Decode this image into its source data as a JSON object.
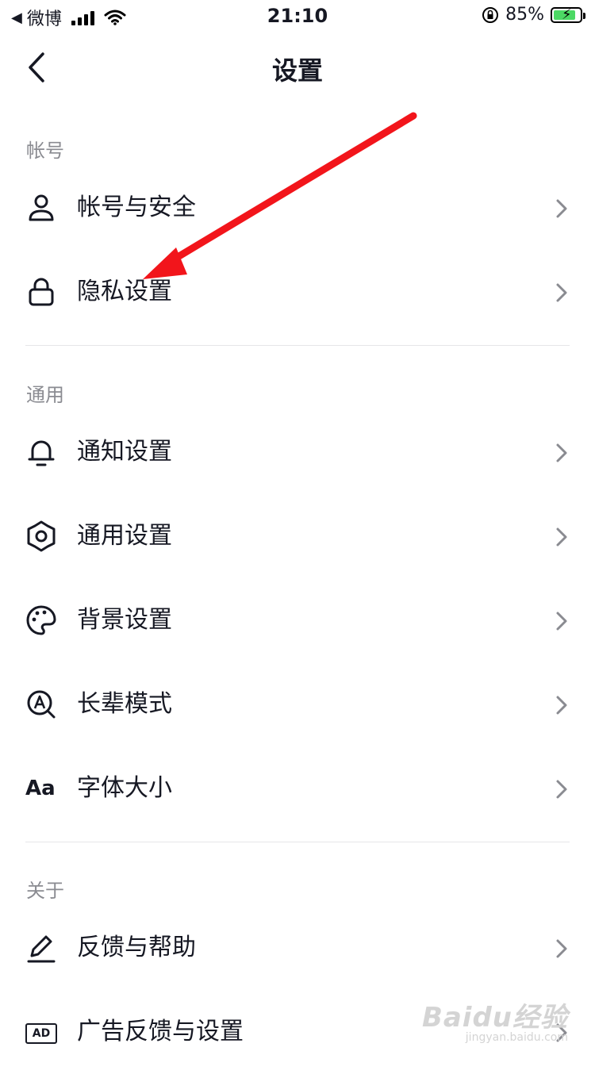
{
  "status_bar": {
    "back_app": "微博",
    "time": "21:10",
    "battery_percent": "85%",
    "battery_level": 0.85
  },
  "nav": {
    "title": "设置"
  },
  "sections": [
    {
      "header": "帐号",
      "items": [
        {
          "label": "帐号与安全",
          "icon": "user-icon"
        },
        {
          "label": "隐私设置",
          "icon": "lock-icon"
        }
      ]
    },
    {
      "header": "通用",
      "items": [
        {
          "label": "通知设置",
          "icon": "bell-icon"
        },
        {
          "label": "通用设置",
          "icon": "gear-icon"
        },
        {
          "label": "背景设置",
          "icon": "palette-icon"
        },
        {
          "label": "长辈模式",
          "icon": "elder-mode-icon"
        },
        {
          "label": "字体大小",
          "icon": "font-size-icon",
          "icon_text": "Aa"
        }
      ]
    },
    {
      "header": "关于",
      "items": [
        {
          "label": "反馈与帮助",
          "icon": "edit-icon"
        },
        {
          "label": "广告反馈与设置",
          "icon": "ad-icon",
          "icon_text": "AD"
        }
      ]
    }
  ],
  "annotation": {
    "color": "#f2151b"
  },
  "watermark": {
    "main": "Baidu经验",
    "sub": "jingyan.baidu.com"
  }
}
